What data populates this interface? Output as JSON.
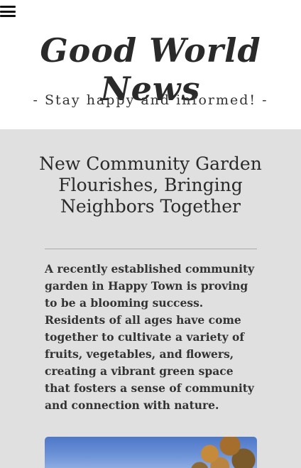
{
  "header": {
    "menu_icon": "hamburger-menu-icon",
    "site_title": "Good World News",
    "tagline": "- Stay happy and informed! -"
  },
  "article": {
    "title": "New Community Garden Flourishes, Bringing Neighbors Together",
    "body": "A recently established community garden in Happy Town is proving to be a blooming success. Residents of all ages have come together to cultivate a variety of fruits, vegetables, and flowers, creating a vibrant green space that fosters a sense of community and connection with nature."
  },
  "colors": {
    "header_background": "#ffffff",
    "content_background": "#e0e0e0",
    "text": "#2b2b2b"
  }
}
